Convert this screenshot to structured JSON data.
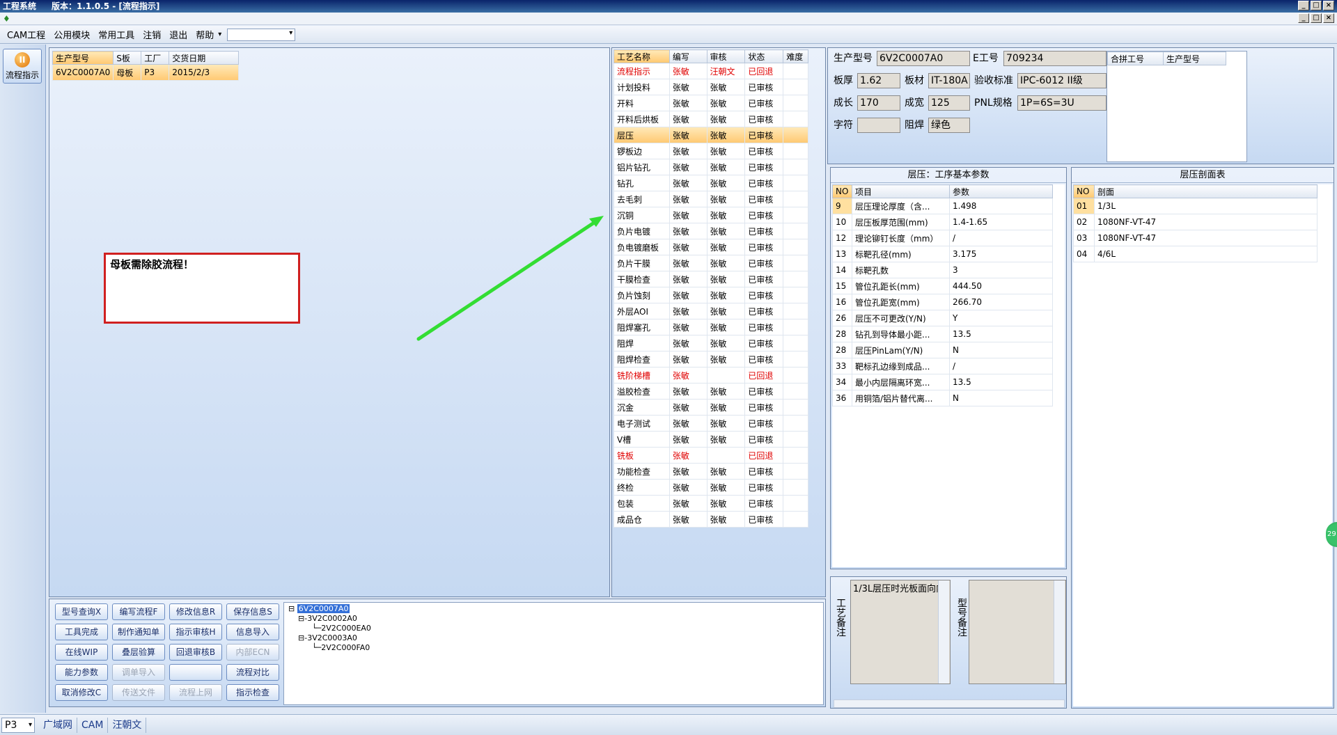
{
  "window": {
    "app_name": "工程系统",
    "version": "版本：1.1.0.5 - [流程指示]"
  },
  "menu": [
    "CAM工程",
    "公用模块",
    "常用工具",
    "注销",
    "退出",
    "帮助"
  ],
  "left_tool": {
    "flow_label": "流程指示"
  },
  "orders": {
    "headers": [
      "生产型号",
      "S板",
      "工厂",
      "交货日期"
    ],
    "rows": [
      [
        "6V2C0007A0",
        "母板",
        "P3",
        "2015/2/3"
      ]
    ]
  },
  "note_box": "母板需除胶流程！",
  "process": {
    "headers": [
      "工艺名称",
      "编写",
      "审核",
      "状态",
      "难度"
    ],
    "rows": [
      {
        "name": "流程指示",
        "writer": "张敏",
        "reviewer": "汪朝文",
        "status": "已回退",
        "level": "",
        "red": true
      },
      {
        "name": "计划投料",
        "writer": "张敏",
        "reviewer": "张敏",
        "status": "已审核",
        "level": ""
      },
      {
        "name": "开料",
        "writer": "张敏",
        "reviewer": "张敏",
        "status": "已审核",
        "level": ""
      },
      {
        "name": "开料后烘板",
        "writer": "张敏",
        "reviewer": "张敏",
        "status": "已审核",
        "level": ""
      },
      {
        "name": "层压",
        "writer": "张敏",
        "reviewer": "张敏",
        "status": "已审核",
        "level": "",
        "selected": true
      },
      {
        "name": "锣板边",
        "writer": "张敏",
        "reviewer": "张敏",
        "status": "已审核",
        "level": ""
      },
      {
        "name": "铝片钻孔",
        "writer": "张敏",
        "reviewer": "张敏",
        "status": "已审核",
        "level": ""
      },
      {
        "name": "钻孔",
        "writer": "张敏",
        "reviewer": "张敏",
        "status": "已审核",
        "level": ""
      },
      {
        "name": "去毛刺",
        "writer": "张敏",
        "reviewer": "张敏",
        "status": "已审核",
        "level": ""
      },
      {
        "name": "沉铜",
        "writer": "张敏",
        "reviewer": "张敏",
        "status": "已审核",
        "level": ""
      },
      {
        "name": "负片电镀",
        "writer": "张敏",
        "reviewer": "张敏",
        "status": "已审核",
        "level": ""
      },
      {
        "name": "负电镀磨板",
        "writer": "张敏",
        "reviewer": "张敏",
        "status": "已审核",
        "level": ""
      },
      {
        "name": "负片干膜",
        "writer": "张敏",
        "reviewer": "张敏",
        "status": "已审核",
        "level": ""
      },
      {
        "name": "干膜检查",
        "writer": "张敏",
        "reviewer": "张敏",
        "status": "已审核",
        "level": ""
      },
      {
        "name": "负片蚀刻",
        "writer": "张敏",
        "reviewer": "张敏",
        "status": "已审核",
        "level": ""
      },
      {
        "name": "外层AOI",
        "writer": "张敏",
        "reviewer": "张敏",
        "status": "已审核",
        "level": ""
      },
      {
        "name": "阻焊塞孔",
        "writer": "张敏",
        "reviewer": "张敏",
        "status": "已审核",
        "level": ""
      },
      {
        "name": "阻焊",
        "writer": "张敏",
        "reviewer": "张敏",
        "status": "已审核",
        "level": ""
      },
      {
        "name": "阻焊检查",
        "writer": "张敏",
        "reviewer": "张敏",
        "status": "已审核",
        "level": ""
      },
      {
        "name": "铣阶梯槽",
        "writer": "张敏",
        "reviewer": "",
        "status": "已回退",
        "level": "",
        "red": true
      },
      {
        "name": "溢胶检查",
        "writer": "张敏",
        "reviewer": "张敏",
        "status": "已审核",
        "level": ""
      },
      {
        "name": "沉金",
        "writer": "张敏",
        "reviewer": "张敏",
        "status": "已审核",
        "level": ""
      },
      {
        "name": "电子测试",
        "writer": "张敏",
        "reviewer": "张敏",
        "status": "已审核",
        "level": ""
      },
      {
        "name": "V槽",
        "writer": "张敏",
        "reviewer": "张敏",
        "status": "已审核",
        "level": ""
      },
      {
        "name": "铣板",
        "writer": "张敏",
        "reviewer": "",
        "status": "已回退",
        "level": "",
        "red": true
      },
      {
        "name": "功能检查",
        "writer": "张敏",
        "reviewer": "张敏",
        "status": "已审核",
        "level": ""
      },
      {
        "name": "终检",
        "writer": "张敏",
        "reviewer": "张敏",
        "status": "已审核",
        "level": ""
      },
      {
        "name": "包装",
        "writer": "张敏",
        "reviewer": "张敏",
        "status": "已审核",
        "level": ""
      },
      {
        "name": "成品仓",
        "writer": "张敏",
        "reviewer": "张敏",
        "status": "已审核",
        "level": ""
      }
    ]
  },
  "info": {
    "model_label": "生产型号",
    "model_value": "6V2C0007A0",
    "eno_label": "E工号",
    "eno_value": "709234",
    "thickness_label": "板厚",
    "thickness_value": "1.62",
    "material_label": "板材",
    "material_value": "IT-180A",
    "standard_label": "验收标准",
    "standard_value": "IPC-6012 II级",
    "length_label": "成长",
    "length_value": "170",
    "width_label": "成宽",
    "width_value": "125",
    "pnl_label": "PNL规格",
    "pnl_value": "1P=6S=3U",
    "char_label": "字符",
    "char_value": "",
    "mask_label": "阻焊",
    "mask_value": "绿色",
    "merge_headers": [
      "合拼工号",
      "生产型号"
    ]
  },
  "params": {
    "title": "层压：工序基本参数",
    "headers": [
      "NO",
      "项目",
      "参数"
    ],
    "rows": [
      [
        "9",
        "层压理论厚度（含...",
        "1.498"
      ],
      [
        "10",
        "层压板厚范围(mm)",
        "1.4-1.65"
      ],
      [
        "12",
        "理论铆钉长度（mm）",
        "/"
      ],
      [
        "13",
        "标靶孔径(mm)",
        "3.175"
      ],
      [
        "14",
        "标靶孔数",
        "3"
      ],
      [
        "15",
        "管位孔距长(mm)",
        "444.50"
      ],
      [
        "16",
        "管位孔距宽(mm)",
        "266.70"
      ],
      [
        "26",
        "层压不可更改(Y/N)",
        "Y"
      ],
      [
        "28",
        "钻孔到导体最小距...",
        "13.5"
      ],
      [
        "28",
        "层压PinLam(Y/N)",
        "N"
      ],
      [
        "33",
        "靶标孔边缘到成品...",
        "/"
      ],
      [
        "34",
        "最小内层隔离环宽...",
        "13.5"
      ],
      [
        "36",
        "用铜箔/铝片替代离...",
        "N"
      ]
    ]
  },
  "stackup": {
    "title": "层压剖面表",
    "headers": [
      "NO",
      "剖面"
    ],
    "rows": [
      [
        "01",
        "1/3L"
      ],
      [
        "02",
        "1080NF-VT-47"
      ],
      [
        "03",
        "1080NF-VT-47"
      ],
      [
        "04",
        "4/6L"
      ]
    ]
  },
  "remarks": {
    "process_label": "工艺备注",
    "process_text": "1/3L层压时光板面向内",
    "model_label": "型号备注",
    "model_text": ""
  },
  "buttons": [
    [
      "型号查询X",
      "编写流程F",
      "修改信息R",
      "保存信息S"
    ],
    [
      "工具完成",
      "制作通知单",
      "指示审核H",
      "信息导入"
    ],
    [
      "在线WIP",
      "叠层验算",
      "回退审核B",
      "内部ECN"
    ],
    [
      "能力参数",
      "调单导入",
      "",
      "流程对比"
    ],
    [
      "取消修改C",
      "传送文件",
      "流程上网",
      "指示检查"
    ]
  ],
  "disabled_buttons": [
    "内部ECN",
    "调单导入",
    "传送文件",
    "流程上网"
  ],
  "tree": {
    "root": "6V2C0007A0",
    "nodes": [
      {
        "label": "3V2C0002A0",
        "child": "2V2C000EA0"
      },
      {
        "label": "3V2C0003A0",
        "child": "2V2C000FA0"
      }
    ]
  },
  "status_bar": {
    "factory": "P3",
    "items": [
      "广域网",
      "CAM",
      "汪朝文"
    ]
  },
  "edge_badge": "29"
}
